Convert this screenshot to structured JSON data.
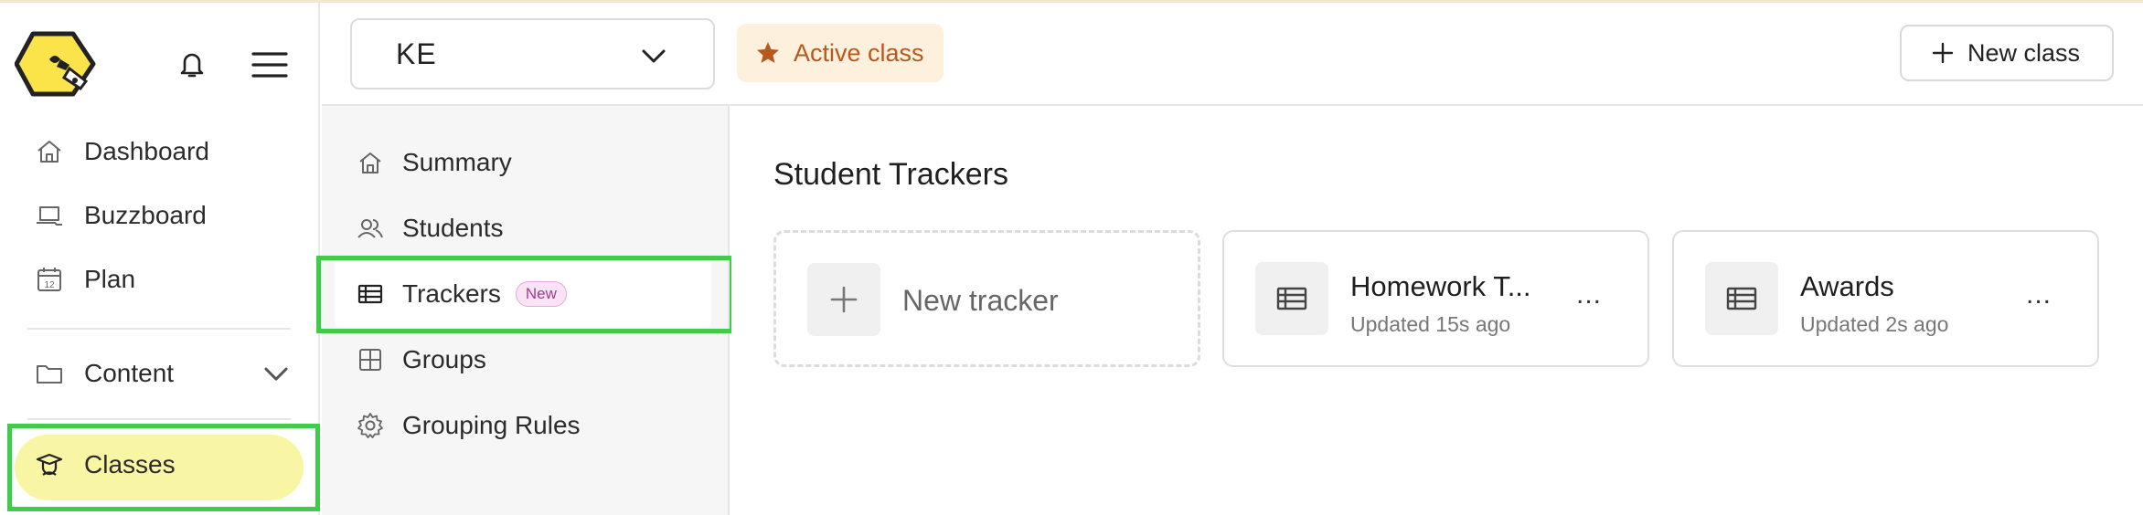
{
  "sidebar": {
    "items": [
      {
        "label": "Dashboard",
        "icon": "home-icon"
      },
      {
        "label": "Buzzboard",
        "icon": "laptop-icon"
      },
      {
        "label": "Plan",
        "icon": "calendar-icon",
        "calendar_day": "12"
      },
      {
        "label": "Content",
        "icon": "folder-icon"
      },
      {
        "label": "Classes",
        "icon": "graduate-icon"
      }
    ]
  },
  "header": {
    "class_select": {
      "value": "KE"
    },
    "active_badge": "Active class",
    "new_class_label": "New class"
  },
  "subnav": {
    "items": [
      {
        "label": "Summary",
        "icon": "home-icon"
      },
      {
        "label": "Students",
        "icon": "users-icon"
      },
      {
        "label": "Trackers",
        "icon": "table-icon",
        "badge": "New"
      },
      {
        "label": "Groups",
        "icon": "grid-icon"
      },
      {
        "label": "Grouping Rules",
        "icon": "gear-icon"
      }
    ]
  },
  "main": {
    "title": "Student Trackers",
    "new_tracker_label": "New tracker",
    "trackers": [
      {
        "title": "Homework T...",
        "updated": "Updated 15s ago"
      },
      {
        "title": "Awards",
        "updated": "Updated 2s ago"
      }
    ],
    "menu_glyph": "..."
  },
  "colors": {
    "highlight": "#3fcc4a",
    "active_pill": "#f8f6a4",
    "badge_bg": "#fdf1dd",
    "badge_text": "#b8581c",
    "logo_yellow": "#fbe34a"
  }
}
